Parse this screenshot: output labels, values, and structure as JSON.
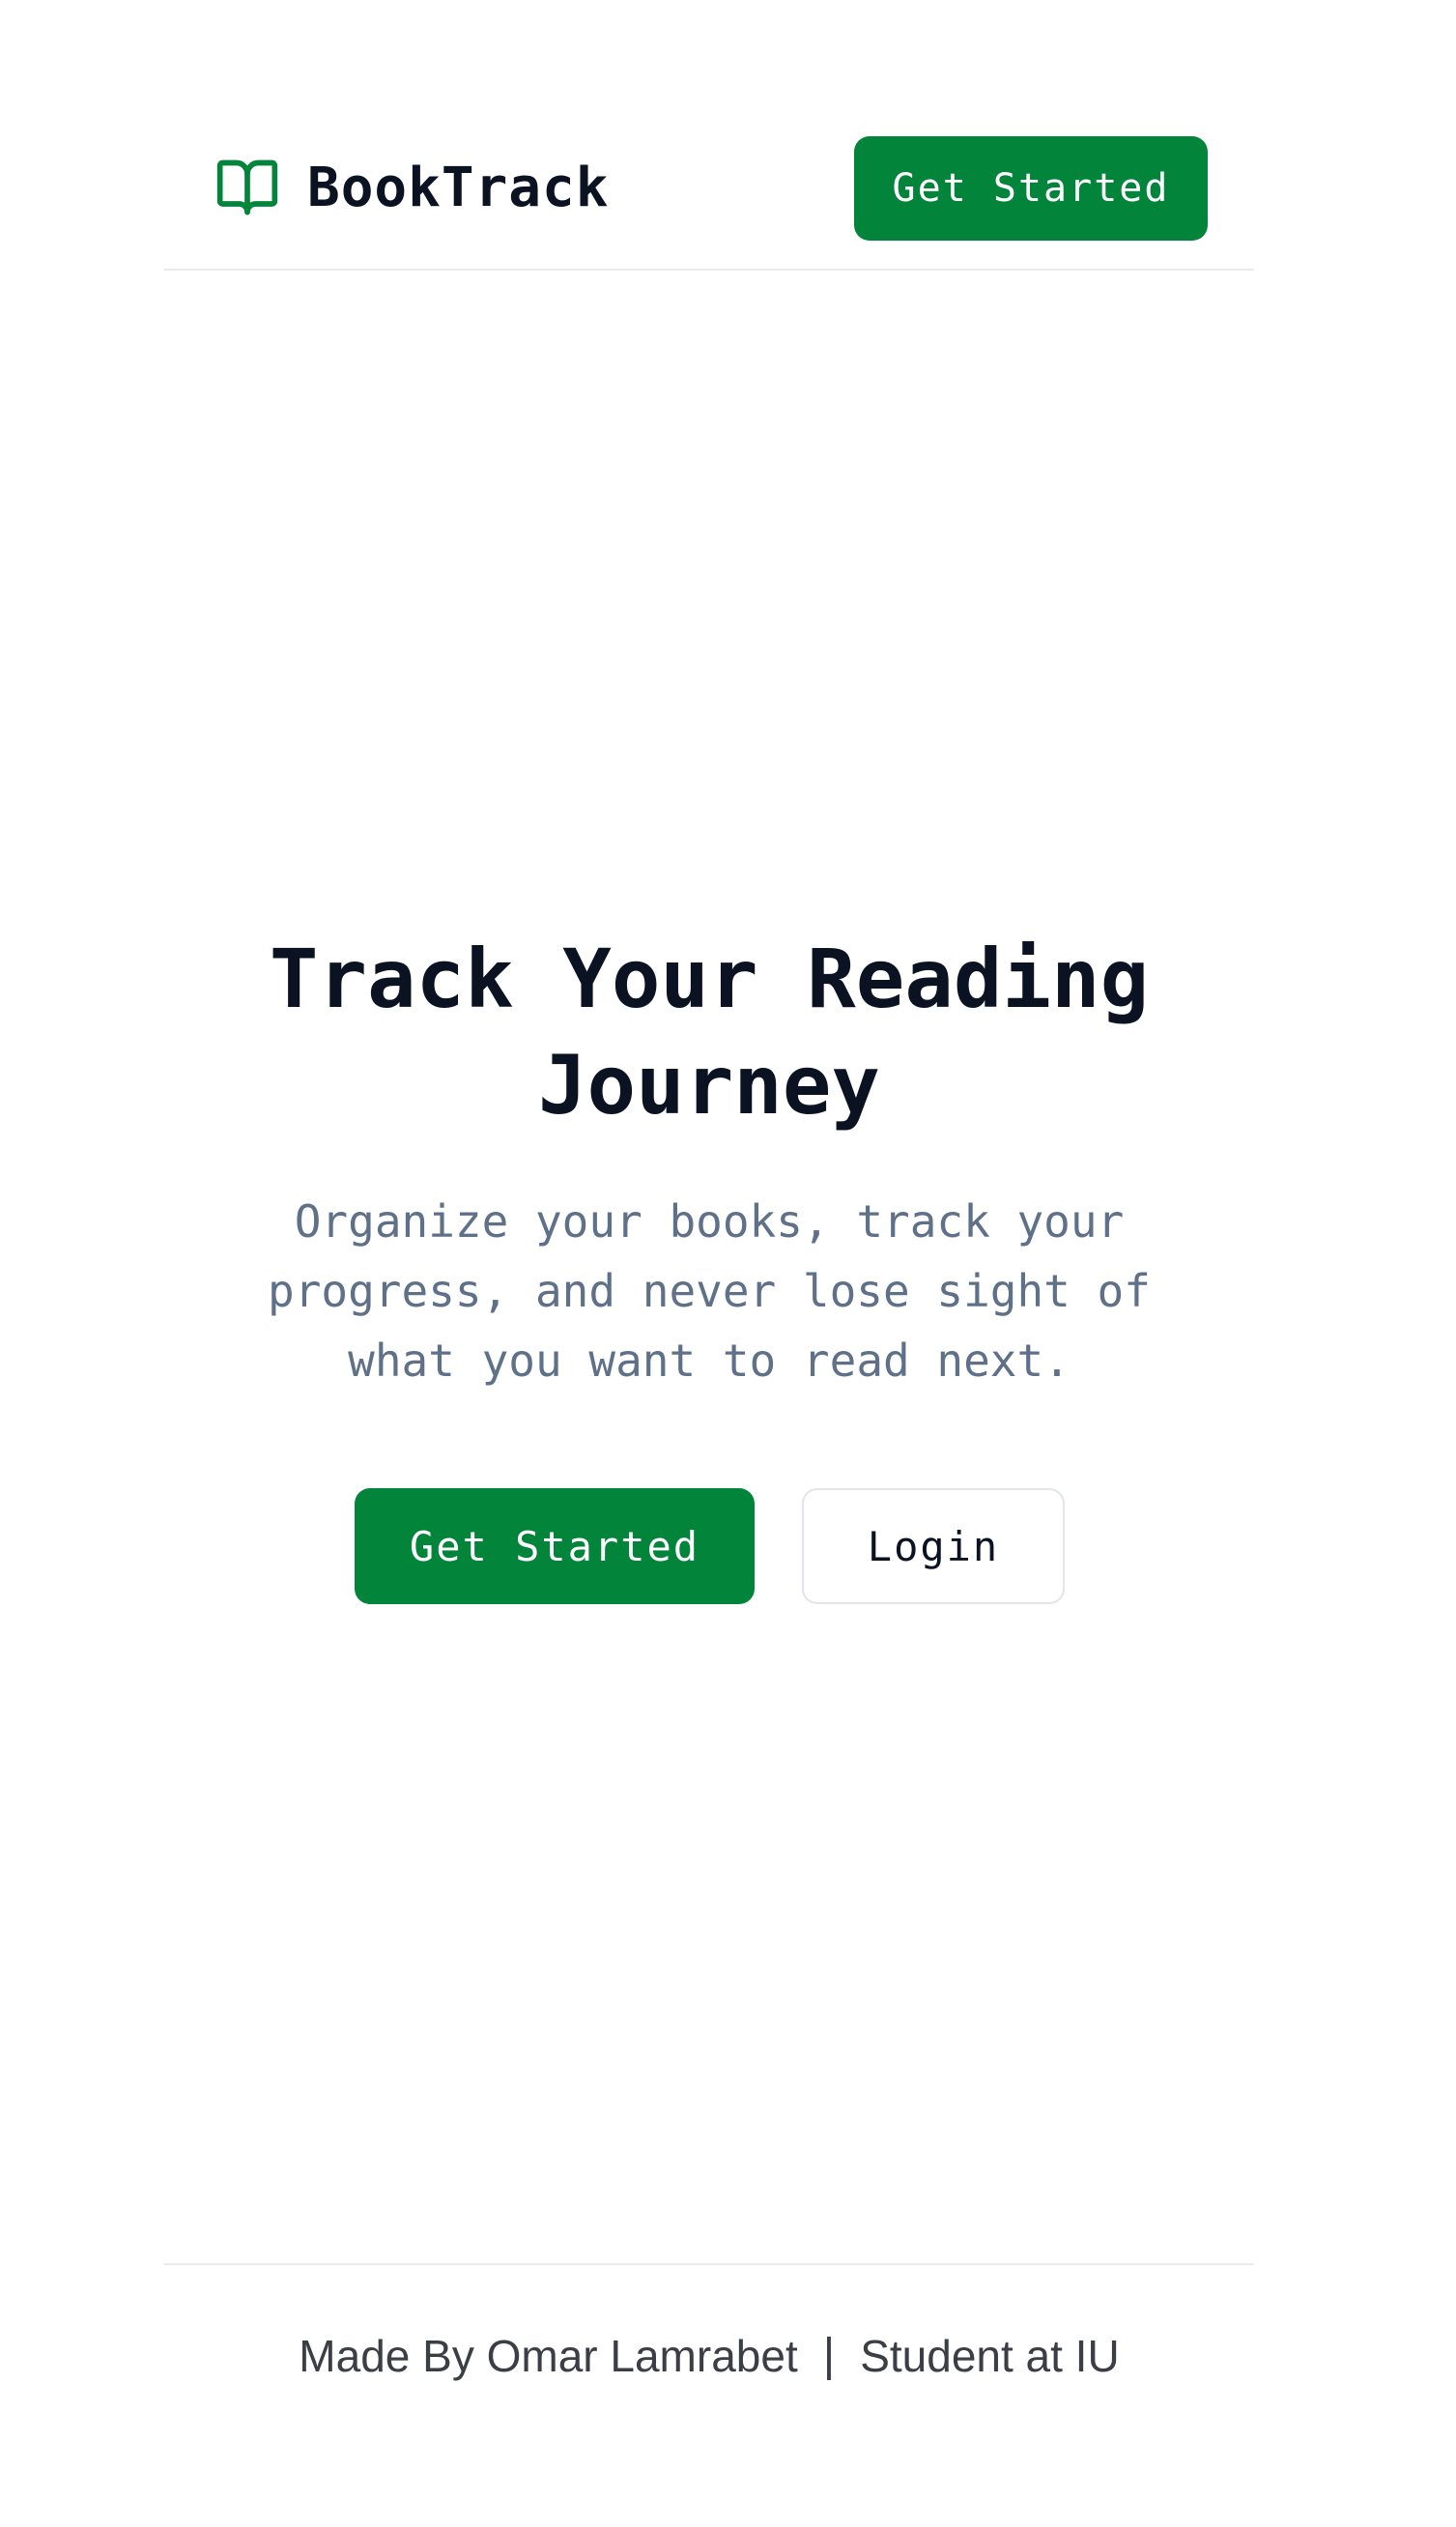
{
  "colors": {
    "brand_green": "#03843b",
    "title": "#0b1222",
    "subtitle": "#5f7089",
    "footer_text": "#3b3e45",
    "divider": "#e8eaee"
  },
  "header": {
    "brand_icon": "open-book-icon",
    "brand_name": "BookTrack",
    "cta_label": "Get Started"
  },
  "hero": {
    "title_line1": "Track Your Reading",
    "title_line2": "Journey",
    "subtitle_line1": "Organize your books, track your",
    "subtitle_line2": "progress, and never lose sight of",
    "subtitle_line3": "what you want to read next.",
    "primary_label": "Get Started",
    "secondary_label": "Login"
  },
  "footer": {
    "made_by": "Made By Omar Lamrabet",
    "separator": "|",
    "school": "Student at IU"
  }
}
